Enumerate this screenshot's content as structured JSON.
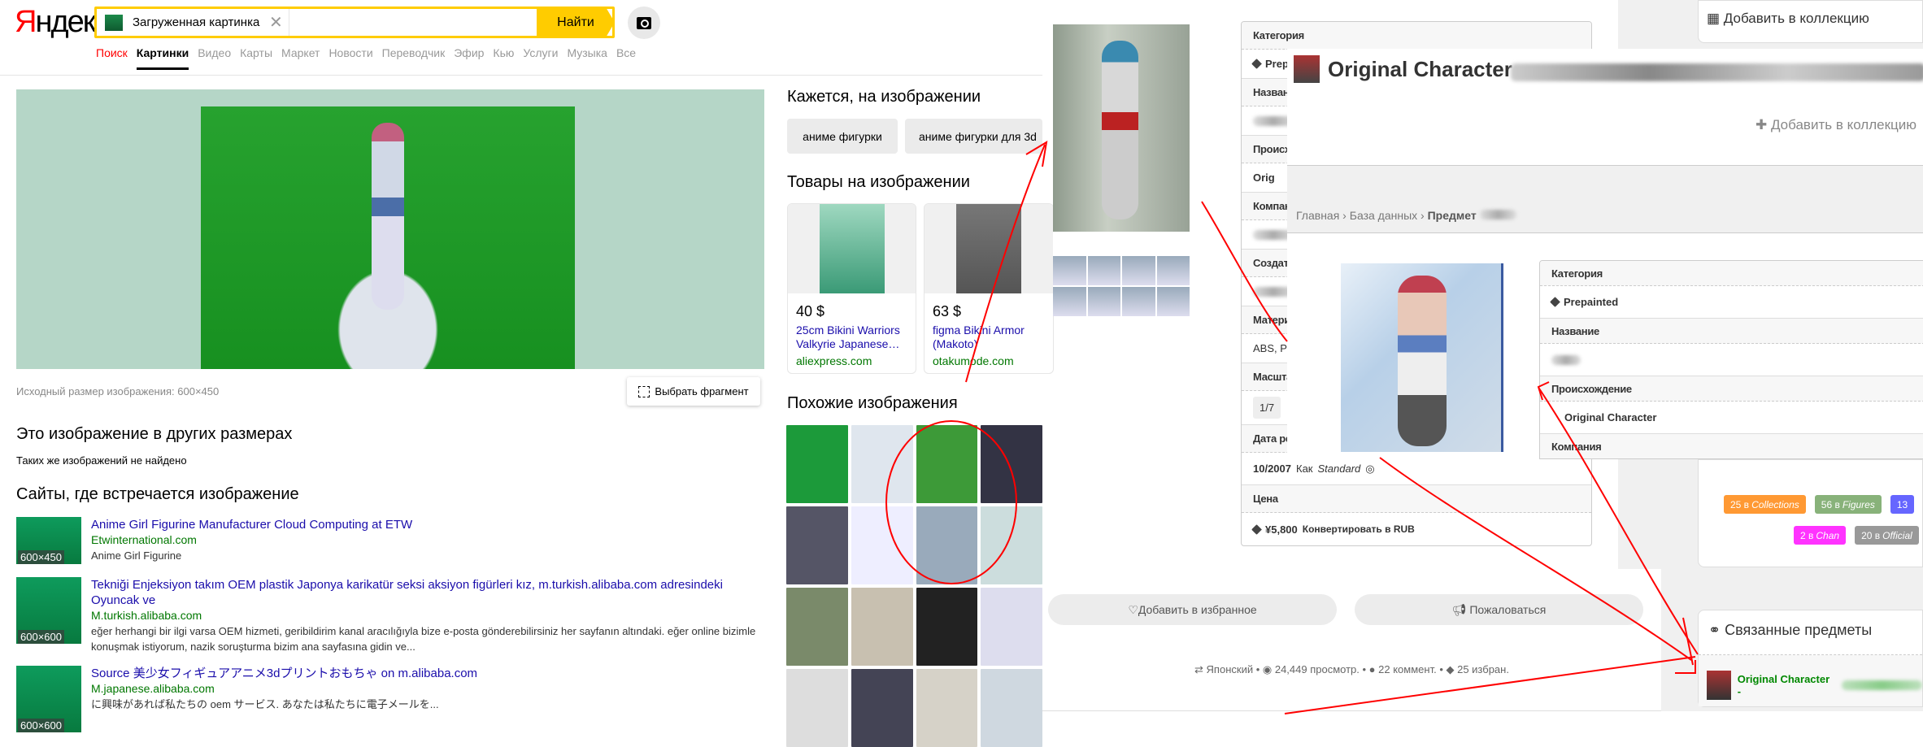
{
  "yandex": {
    "logo_first": "Я",
    "logo_rest": "ндекс",
    "search": {
      "chip_label": "Загруженная картинка",
      "value": "",
      "find_button": "Найти"
    },
    "nav": [
      "Поиск",
      "Картинки",
      "Видео",
      "Карты",
      "Маркет",
      "Новости",
      "Переводчик",
      "Эфир",
      "Кью",
      "Услуги",
      "Музыка",
      "Все"
    ],
    "image_size_label": "Исходный размер изображения: 600×450",
    "select_fragment": "Выбрать фрагмент",
    "other_sizes_title": "Это изображение в других размерах",
    "other_sizes_none": "Таких же изображений не найдено",
    "sites_title": "Сайты, где встречается изображение",
    "sites": [
      {
        "title": "Anime Girl Figurine Manufacturer Cloud Computing at ETW",
        "domain": "Etwinternational.com",
        "desc": "Anime Girl Figurine",
        "size": "600×450"
      },
      {
        "title": "Tekniği Enjeksiyon takım OEM plastik Japonya karikatür seksi aksiyon figürleri kız, m.turkish.alibaba.com adresindeki Oyuncak ve",
        "domain": "M.turkish.alibaba.com",
        "desc": "eğer herhangi bir ilgi varsa OEM hizmeti, geribildirim kanal aracılığıyla bize e-posta gönderebilirsiniz her sayfanın altındaki. eğer online bizimle konuşmak istiyorum, nazik soruşturma bizim ana sayfasına gidin ve...",
        "size": "600×600"
      },
      {
        "title": "Source 美少女フィギュアアニメ3dプリントおもちゃ on m.alibaba.com",
        "domain": "M.japanese.alibaba.com",
        "desc": "に興味があれば私たちの oem サービス. あなたは私たちに電子メールを...",
        "size": "600×600"
      }
    ],
    "seems_title": "Кажется, на изображении",
    "seems_tags": [
      "аниме фигурки",
      "аниме фигурки для 3d"
    ],
    "products_title": "Товары на изображении",
    "products": [
      {
        "price": "40 $",
        "name": "25cm Bikini Warriors Valkyrie Japanese…",
        "shop": "aliexpress.com"
      },
      {
        "price": "63 $",
        "name": "figma Bikini Armor (Makoto)",
        "shop": "otakumode.com"
      }
    ],
    "similar_title": "Похожие изображения"
  },
  "site": {
    "top_add_collection": "Добавить в коллекцию",
    "item_title": "Original Character -",
    "add_collection": "Добавить в коллекцию",
    "breadcrumb": [
      "Главная",
      "База данных",
      "Предмет"
    ],
    "back_table": {
      "category_h": "Категория",
      "category_v": "Prep",
      "name_h": "Назван",
      "origin_h": "Происх",
      "origin_v": "Orig",
      "company_h": "Компан",
      "creator_h": "Создат",
      "material_h": "Матери",
      "material_v": "ABS, PV",
      "scale_h": "Масшта",
      "scale_v": "1/7",
      "release_h": "Дата ре",
      "release_v": "10/2007",
      "release_as": "Как",
      "release_type": "Standard",
      "price_h": "Цена",
      "price_v": "¥5,800",
      "price_convert": "Конвертировать в RUB"
    },
    "front_table": {
      "category_h": "Категория",
      "category_v": "Prepainted",
      "name_h": "Название",
      "origin_h": "Происхождение",
      "origin_v": "Original Character",
      "company_h": "Компания"
    },
    "badges": [
      {
        "count": "25 в",
        "label": "Collections",
        "color": "#ff9933"
      },
      {
        "count": "56 в",
        "label": "Figures",
        "color": "#88b27a"
      },
      {
        "count": "13",
        "label": "",
        "color": "#6666ff"
      },
      {
        "count": "2 в",
        "label": "Chan",
        "color": "#ff33ff"
      },
      {
        "count": "20 в",
        "label": "Official",
        "color": "#999999"
      }
    ],
    "favorite_button": "Добавить в избранное",
    "report_button": "Пожаловаться",
    "stats": {
      "lang": "Японский",
      "views": "24,449 просмотр.",
      "comments": "22 коммент.",
      "favs": "25 избран."
    },
    "related_title": "Связанные предметы",
    "related_item": "Original Character -"
  },
  "colors": {
    "yandex_yellow": "#ffcc00",
    "link": "#1a0dab",
    "domain": "#007700",
    "annotation": "#ff0000"
  }
}
